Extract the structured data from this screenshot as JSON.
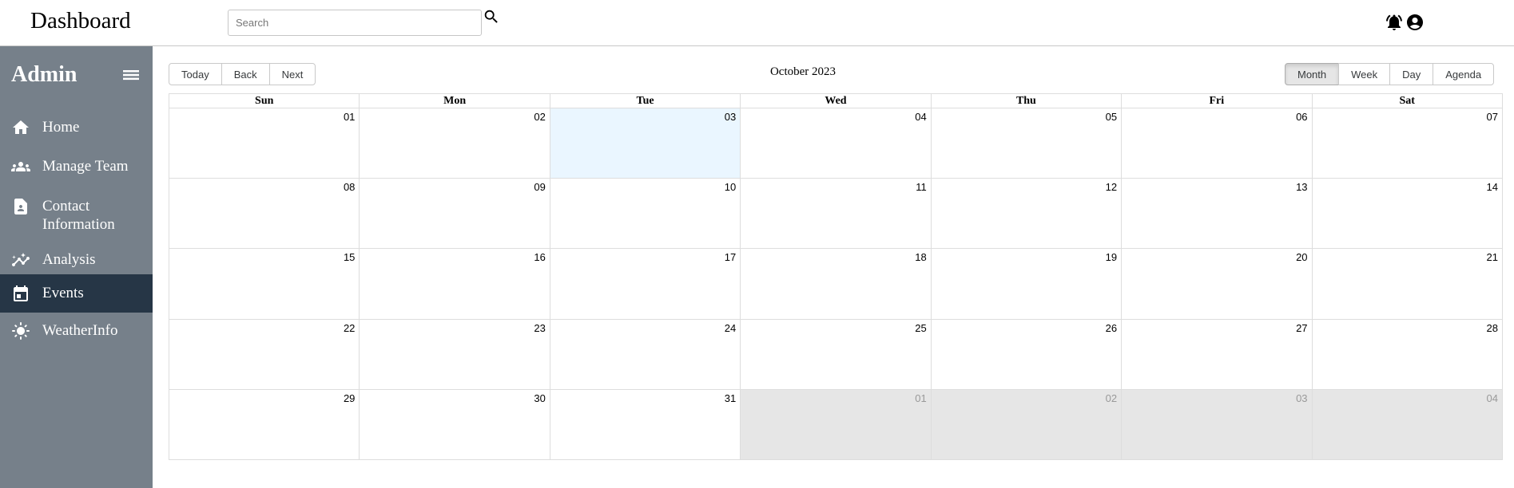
{
  "header": {
    "title": "Dashboard",
    "search": {
      "placeholder": "Search",
      "value": ""
    }
  },
  "sidebar": {
    "title": "Admin",
    "items": [
      {
        "label": "Home",
        "icon": "home-icon",
        "active": false
      },
      {
        "label": "Manage Team",
        "icon": "team-icon",
        "active": false
      },
      {
        "label": "Contact Information",
        "icon": "contact-icon",
        "active": false
      },
      {
        "label": "Analysis",
        "icon": "analysis-icon",
        "active": false
      },
      {
        "label": "Events",
        "icon": "calendar-icon",
        "active": true
      },
      {
        "label": "WeatherInfo",
        "icon": "sun-icon",
        "active": false
      }
    ],
    "colors": {
      "background": "#76808a",
      "active": "#263646"
    }
  },
  "calendar": {
    "nav_buttons": [
      "Today",
      "Back",
      "Next"
    ],
    "label": "October 2023",
    "views": [
      "Month",
      "Week",
      "Day",
      "Agenda"
    ],
    "active_view": "Month",
    "weekdays": [
      "Sun",
      "Mon",
      "Tue",
      "Wed",
      "Thu",
      "Fri",
      "Sat"
    ],
    "weeks": [
      [
        {
          "d": "01"
        },
        {
          "d": "02"
        },
        {
          "d": "03",
          "today": true
        },
        {
          "d": "04"
        },
        {
          "d": "05"
        },
        {
          "d": "06"
        },
        {
          "d": "07"
        }
      ],
      [
        {
          "d": "08"
        },
        {
          "d": "09"
        },
        {
          "d": "10"
        },
        {
          "d": "11"
        },
        {
          "d": "12"
        },
        {
          "d": "13"
        },
        {
          "d": "14"
        }
      ],
      [
        {
          "d": "15"
        },
        {
          "d": "16"
        },
        {
          "d": "17"
        },
        {
          "d": "18"
        },
        {
          "d": "19"
        },
        {
          "d": "20"
        },
        {
          "d": "21"
        }
      ],
      [
        {
          "d": "22"
        },
        {
          "d": "23"
        },
        {
          "d": "24"
        },
        {
          "d": "25"
        },
        {
          "d": "26"
        },
        {
          "d": "27"
        },
        {
          "d": "28"
        }
      ],
      [
        {
          "d": "29"
        },
        {
          "d": "30"
        },
        {
          "d": "31"
        },
        {
          "d": "01",
          "off": true
        },
        {
          "d": "02",
          "off": true
        },
        {
          "d": "03",
          "off": true
        },
        {
          "d": "04",
          "off": true
        }
      ]
    ],
    "colors": {
      "today": "#eaf6ff",
      "off_range": "#e6e6e6"
    }
  }
}
